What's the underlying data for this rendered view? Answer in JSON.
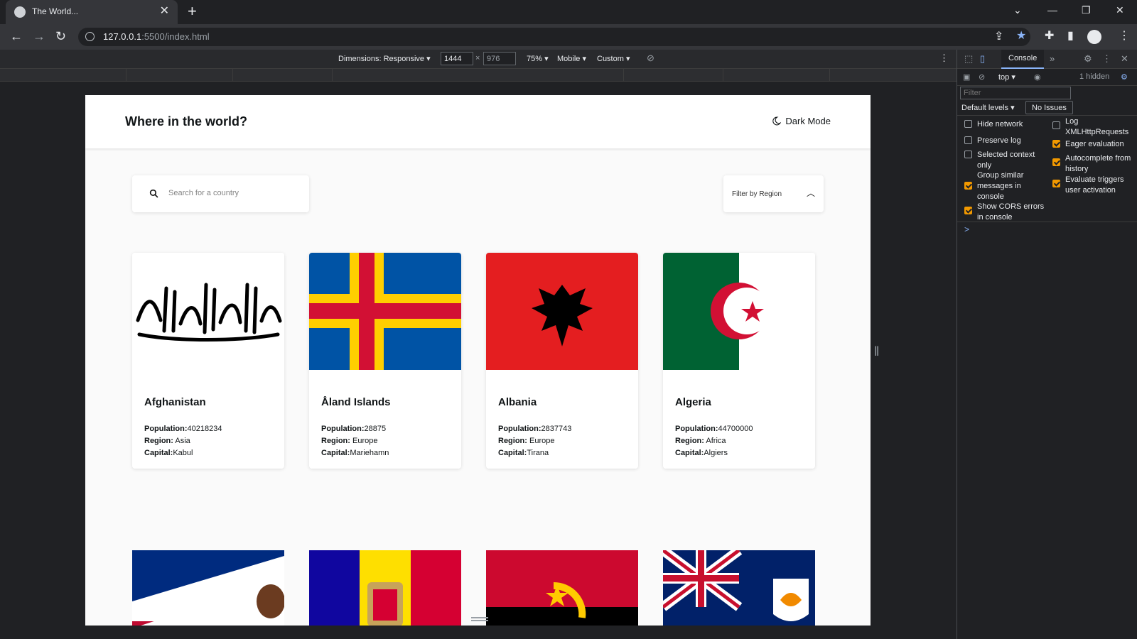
{
  "browser": {
    "tab_title": "The World...",
    "url_host": "127.0.0.1",
    "url_rest": ":5500/index.html"
  },
  "device_toolbar": {
    "dimensions_label": "Dimensions: Responsive ▾",
    "width": "1444",
    "height": "976",
    "zoom": "75% ▾",
    "throttle": "Mobile ▾",
    "custom": "Custom ▾"
  },
  "page": {
    "title": "Where in the world?",
    "dark_mode_label": "Dark Mode",
    "search_placeholder": "Search for a country",
    "filter_label": "Filter by Region",
    "labels": {
      "population": "Population:",
      "region": "Region:",
      "capital": "Capital:"
    },
    "countries": [
      {
        "name": "Afghanistan",
        "population": "40218234",
        "region": "Asia",
        "capital": "Kabul"
      },
      {
        "name": "Åland Islands",
        "population": "28875",
        "region": "Europe",
        "capital": "Mariehamn"
      },
      {
        "name": "Albania",
        "population": "2837743",
        "region": "Europe",
        "capital": "Tirana"
      },
      {
        "name": "Algeria",
        "population": "44700000",
        "region": "Africa",
        "capital": "Algiers"
      }
    ]
  },
  "devtools": {
    "console_tab": "Console",
    "context": "top ▾",
    "hidden_count": "1 hidden",
    "filter_placeholder": "Filter",
    "default_levels": "Default levels ▾",
    "no_issues": "No Issues",
    "options_left": [
      {
        "label": "Hide network",
        "checked": false
      },
      {
        "label": "Preserve log",
        "checked": false
      },
      {
        "label": "Selected context only",
        "checked": false
      },
      {
        "label": "Group similar messages in console",
        "checked": true
      },
      {
        "label": "Show CORS errors in console",
        "checked": true
      }
    ],
    "options_right": [
      {
        "label": "Log XMLHttpRequests",
        "checked": false
      },
      {
        "label": "Eager evaluation",
        "checked": true
      },
      {
        "label": "Autocomplete from history",
        "checked": true
      },
      {
        "label": "Evaluate triggers user activation",
        "checked": true
      }
    ],
    "prompt": ">"
  },
  "colors": {
    "browser_bg": "#202124",
    "page_bg": "#fafafa",
    "text_dark": "#111517",
    "checkbox_on": "#f29900"
  }
}
